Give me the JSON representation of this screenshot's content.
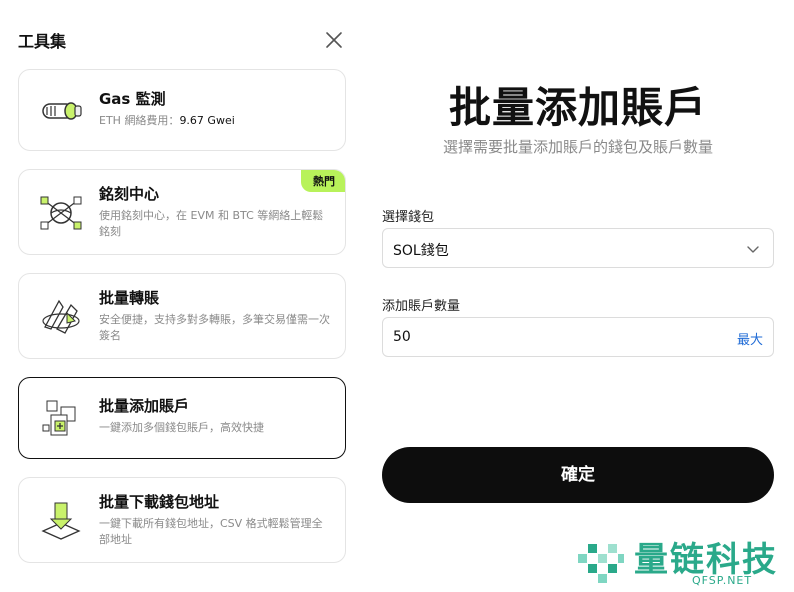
{
  "panel": {
    "title": "工具集",
    "close_icon": "close-icon"
  },
  "tools": [
    {
      "title": "Gas 監測",
      "desc_prefix": "ETH 網絡費用：",
      "desc_value": "9.67 Gwei",
      "icon": "gas-gauge-icon"
    },
    {
      "title": "銘刻中心",
      "desc": "使用銘刻中心，在 EVM 和 BTC 等網絡上輕鬆銘刻",
      "badge": "熱門",
      "icon": "inscription-orb-icon"
    },
    {
      "title": "批量轉賬",
      "desc": "安全便捷，支持多對多轉賬，多筆交易僅需一次簽名",
      "icon": "batch-transfer-icon"
    },
    {
      "title": "批量添加賬戶",
      "desc": "一鍵添加多個錢包賬戶，高效快捷",
      "icon": "add-accounts-icon",
      "active": true
    },
    {
      "title": "批量下載錢包地址",
      "desc": "一鍵下載所有錢包地址，CSV 格式輕鬆管理全部地址",
      "icon": "download-icon"
    }
  ],
  "main": {
    "title": "批量添加賬戶",
    "subtitle": "選擇需要批量添加賬戶的錢包及賬戶數量",
    "wallet_label": "選擇錢包",
    "wallet_value": "SOL錢包",
    "count_label": "添加賬戶數量",
    "count_value": "50",
    "max_label": "最大",
    "confirm_label": "確定"
  },
  "watermark": {
    "name": "量链科技",
    "url": "QFSP.NET"
  },
  "colors": {
    "accent_green": "#b8f25a",
    "link_blue": "#1f6bd6",
    "watermark_teal": "#2aa98a"
  }
}
